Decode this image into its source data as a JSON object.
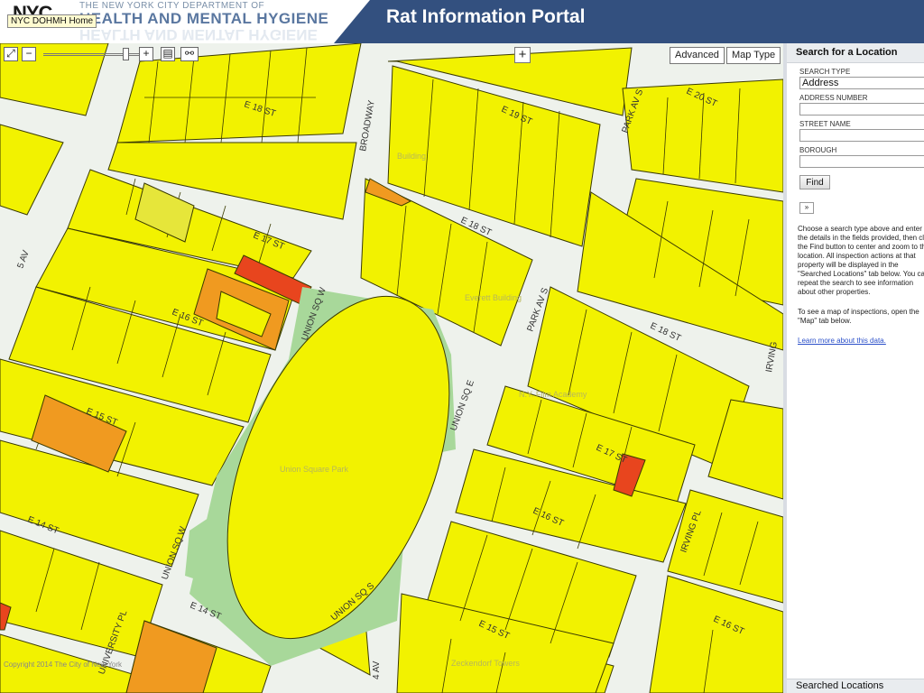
{
  "header": {
    "logo_text": "NYC",
    "department_line1": "THE NEW YORK CITY DEPARTMENT OF",
    "department_line2": "HEALTH AND MENTAL HYGIENE",
    "home_tooltip": "NYC DOHMH Home",
    "portal_title": "Rat Information Portal"
  },
  "map_controls": {
    "zoom_in": "+",
    "zoom_out": "−",
    "advanced_label": "Advanced",
    "map_type_label": "Map Type",
    "copyright": "Copyright 2014 The City of New York"
  },
  "map": {
    "street_labels": [
      "E 18 ST",
      "E 19 ST",
      "BROADWAY",
      "E 20 ST",
      "PARK AV S",
      "E 18 ST",
      "E 17 ST",
      "5 AV",
      "E 16 ST",
      "UNION SQ W",
      "PARK AV S",
      "E 18 ST",
      "E 15 ST",
      "UNION SQ E",
      "E 17 ST",
      "E 14 ST",
      "E 16 ST",
      "UNION SQ W",
      "IRVING PL",
      "E 14 ST",
      "UNION SQ S",
      "E 16 ST",
      "E 15 ST",
      "UNIVERSITY PL",
      "IRVING",
      "4 AV"
    ],
    "building_labels": [
      "Union Square Park",
      "Everett Building",
      "N.Y. Film Academy",
      "Zeckendorf Towers",
      "Building"
    ],
    "colors": {
      "lot": "#f2f200",
      "lot_border": "#3a3a00",
      "street": "#eef2ec",
      "park": "#a8d89a",
      "orange": "#f09a20",
      "red": "#e8451e"
    }
  },
  "sidebar": {
    "title": "Search for a Location",
    "search_type_label": "SEARCH TYPE",
    "search_type_value": "Address",
    "address_number_label": "ADDRESS NUMBER",
    "street_name_label": "STREET NAME",
    "borough_label": "BOROUGH",
    "find_label": "Find",
    "expand_label": "»",
    "help_text_1": "Choose a search type above and enter the details in the fields provided, then click the Find button to center and zoom to that location. All inspection actions at that property will be displayed in the \"Searched Locations\" tab below. You can repeat the search to see information about other properties.",
    "help_text_2": "To see a map of inspections, open the \"Map\" tab below.",
    "learn_more": "Learn more about this data.",
    "bottom_tab": "Searched Locations"
  }
}
